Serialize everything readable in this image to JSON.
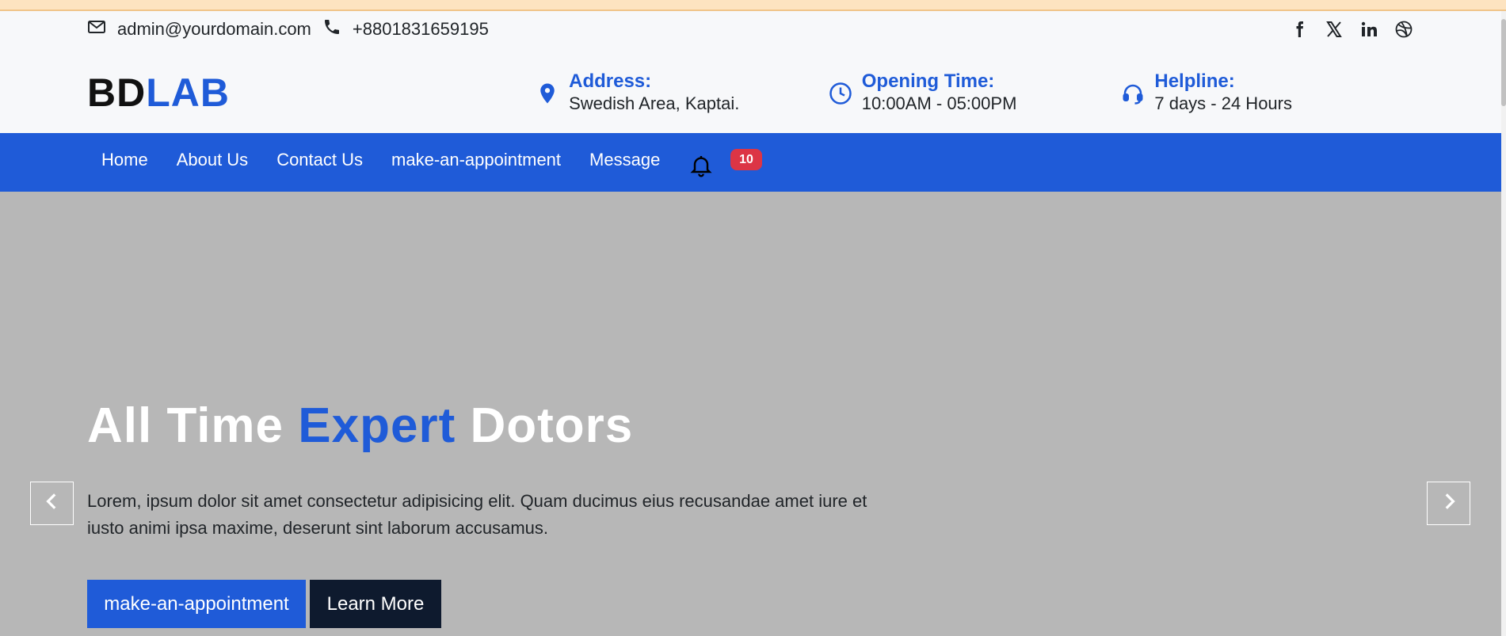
{
  "topbar": {
    "email": "admin@yourdomain.com",
    "phone": "+8801831659195",
    "socials": [
      "facebook-icon",
      "x-icon",
      "linkedin-icon",
      "dribbble-icon"
    ]
  },
  "brand": {
    "logo_dark": "BD",
    "logo_blue": "LAB"
  },
  "info": {
    "address_title": "Address:",
    "address_value": "Swedish Area, Kaptai.",
    "opening_title": "Opening Time:",
    "opening_value": "10:00AM - 05:00PM",
    "helpline_title": "Helpline:",
    "helpline_value": "7 days - 24 Hours"
  },
  "nav": {
    "items": [
      "Home",
      "About Us",
      "Contact Us",
      "make-an-appointment",
      "Message"
    ],
    "notification_count": "10"
  },
  "hero": {
    "title_part1": "All Time ",
    "title_accent": "Expert",
    "title_part2": " Dotors",
    "text": "Lorem, ipsum dolor sit amet consectetur adipisicing elit. Quam ducimus eius recusandae amet iure et iusto animi ipsa maxime, deserunt sint laborum accusamus.",
    "primary_button": "make-an-appointment",
    "secondary_button": "Learn More"
  },
  "colors": {
    "brand_blue": "#1f5bd8",
    "badge_red": "#dc3545",
    "hero_bg": "#b7b7b7",
    "dark_button": "#0e1a2e"
  }
}
